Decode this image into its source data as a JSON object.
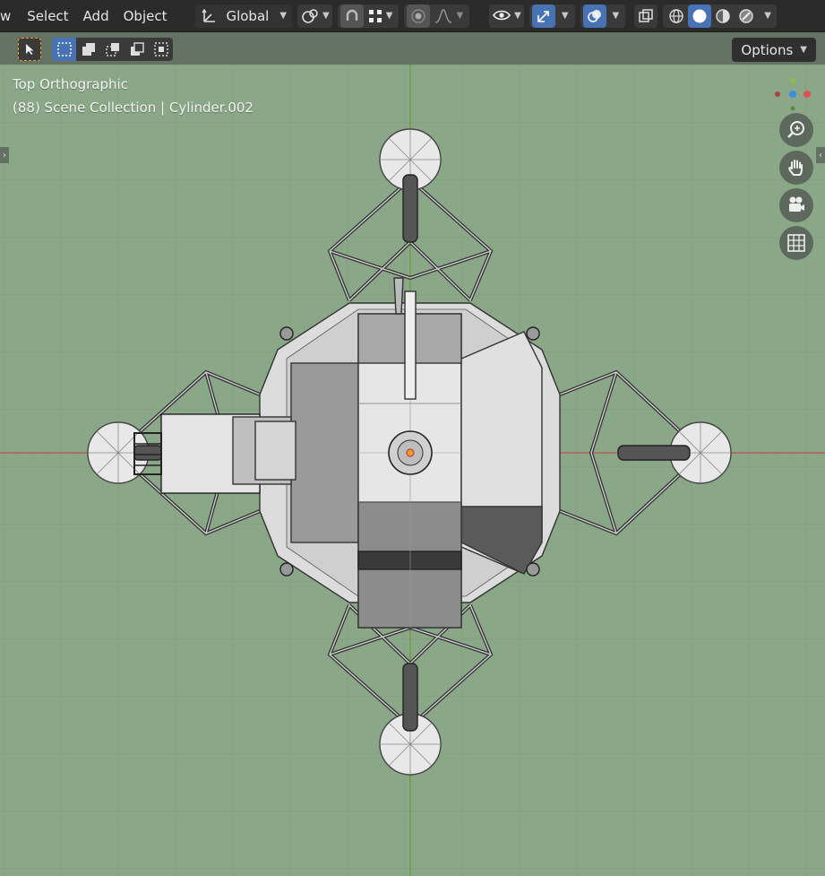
{
  "menu": {
    "view_partial": "w",
    "select": "Select",
    "add": "Add",
    "object": "Object"
  },
  "header": {
    "transform_orientation": "Global",
    "icons": [
      "transform-orientation-icon",
      "pivot-icon",
      "snap-icon",
      "snap-grid-icon",
      "proportional-edit-icon",
      "falloff-icon",
      "visibility-icon",
      "gizmo-icon",
      "overlay-icon",
      "xray-icon",
      "wireframe-shading-icon",
      "solid-shading-icon",
      "material-shading-icon",
      "rendered-shading-icon"
    ]
  },
  "toolbar": {
    "options_label": "Options"
  },
  "viewport": {
    "view_name": "Top Orthographic",
    "collection_info": "(88) Scene Collection | Cylinder.002",
    "background_color": "#8aa888",
    "axis_x_color": "#c0504d",
    "axis_y_color": "#6a9a3a"
  },
  "navigation": [
    "zoom-icon",
    "pan-hand-icon",
    "camera-icon",
    "grid-ortho-icon"
  ]
}
